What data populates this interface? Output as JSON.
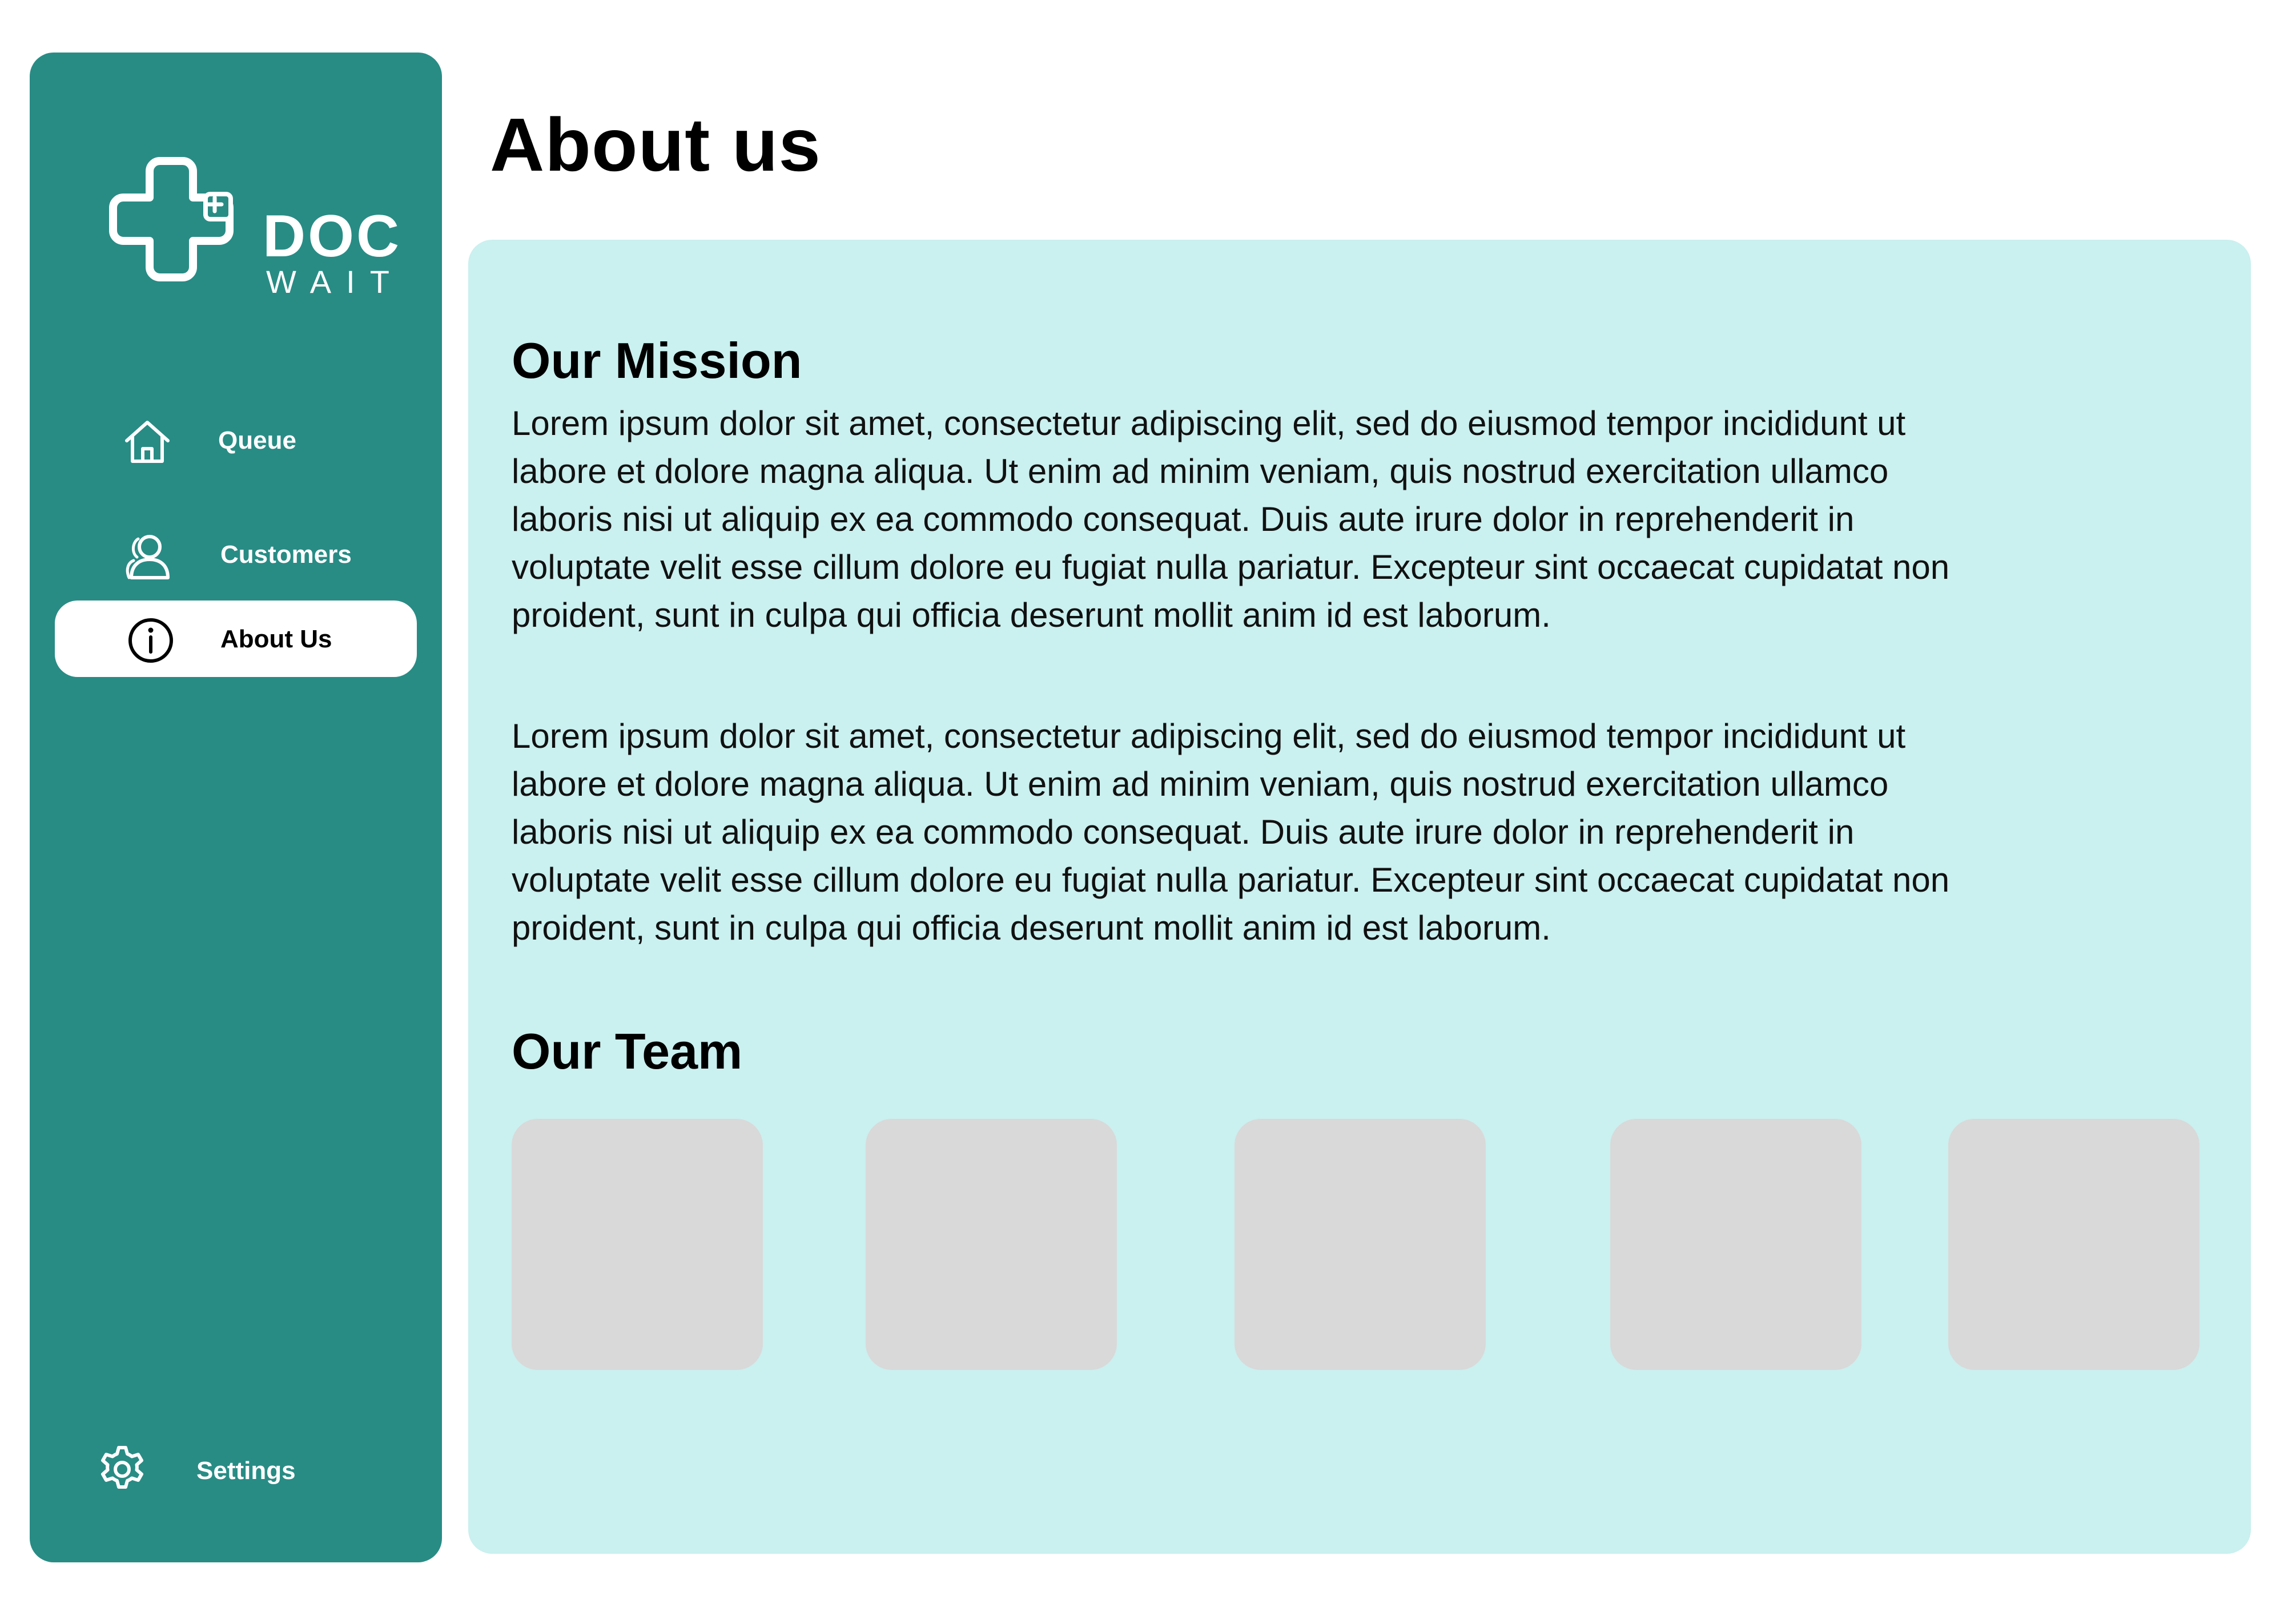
{
  "app": {
    "logo": {
      "brand_top": "DOC",
      "brand_bottom": "WAIT"
    }
  },
  "sidebar": {
    "items": [
      {
        "label": "Queue",
        "icon": "home-icon",
        "active": false
      },
      {
        "label": "Customers",
        "icon": "users-icon",
        "active": false
      },
      {
        "label": "About Us",
        "icon": "info-icon",
        "active": true
      }
    ],
    "settings": {
      "label": "Settings",
      "icon": "gear-icon"
    }
  },
  "main": {
    "page_title": "About us",
    "mission": {
      "title": "Our Mission",
      "paragraphs": [
        "Lorem ipsum dolor sit amet, consectetur adipiscing elit, sed do eiusmod tempor incididunt ut labore et dolore magna aliqua. Ut enim ad minim veniam, quis nostrud exercitation ullamco laboris nisi ut aliquip ex ea commodo consequat. Duis aute irure dolor in reprehenderit in voluptate velit esse cillum dolore eu fugiat nulla pariatur. Excepteur sint occaecat cupidatat non proident, sunt in culpa qui officia deserunt mollit anim id est laborum.",
        "Lorem ipsum dolor sit amet, consectetur adipiscing elit, sed do eiusmod tempor incididunt ut labore et dolore magna aliqua. Ut enim ad minim veniam, quis nostrud exercitation ullamco laboris nisi ut aliquip ex ea commodo consequat. Duis aute irure dolor in reprehenderit in voluptate velit esse cillum dolore eu fugiat nulla pariatur. Excepteur sint occaecat cupidatat non proident, sunt in culpa qui officia deserunt mollit anim id est laborum."
      ]
    },
    "team": {
      "title": "Our Team",
      "members": [
        {},
        {},
        {},
        {},
        {}
      ]
    }
  },
  "colors": {
    "sidebar_bg": "#288c85",
    "content_bg": "#caf0ef",
    "card_placeholder": "#d9d9d9",
    "active_pill": "#ffffff"
  }
}
